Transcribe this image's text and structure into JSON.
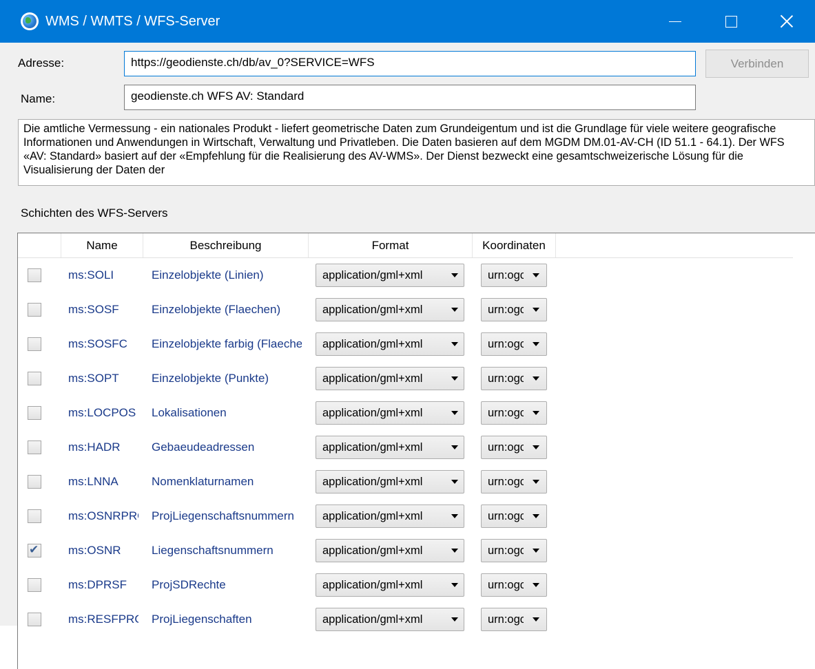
{
  "window": {
    "title": "WMS / WMTS / WFS-Server"
  },
  "form": {
    "address_label": "Adresse:",
    "address_value": "https://geodienste.ch/db/av_0?SERVICE=WFS",
    "connect_button": "Verbinden",
    "name_label": "Name:",
    "name_value": "geodienste.ch WFS AV: Standard",
    "description": "Die amtliche Vermessung - ein nationales Produkt - liefert geometrische Daten zum Grundeigentum und ist die Grundlage für viele weitere geografische Informationen und Anwendungen in Wirtschaft, Verwaltung und Privatleben. Die Daten basieren auf dem MGDM DM.01-AV-CH (ID 51.1 - 64.1). Der WFS «AV: Standard» basiert auf der «Empfehlung für die Realisierung des AV-WMS». Der Dienst bezweckt eine gesamtschweizerische Lösung für die Visualisierung der Daten der"
  },
  "layers": {
    "section_label": "Schichten des WFS-Servers",
    "columns": {
      "name": "Name",
      "description": "Beschreibung",
      "format": "Format",
      "coordinates": "Koordinaten"
    },
    "rows": [
      {
        "checked": false,
        "name": "ms:SOLI",
        "description": "Einzelobjekte (Linien)",
        "format": "application/gml+xml",
        "coords": "urn:ogc"
      },
      {
        "checked": false,
        "name": "ms:SOSF",
        "description": "Einzelobjekte (Flaechen)",
        "format": "application/gml+xml",
        "coords": "urn:ogc"
      },
      {
        "checked": false,
        "name": "ms:SOSFC",
        "description": "Einzelobjekte farbig (Flaechen)",
        "format": "application/gml+xml",
        "coords": "urn:ogc"
      },
      {
        "checked": false,
        "name": "ms:SOPT",
        "description": "Einzelobjekte (Punkte)",
        "format": "application/gml+xml",
        "coords": "urn:ogc"
      },
      {
        "checked": false,
        "name": "ms:LOCPOS",
        "description": "Lokalisationen",
        "format": "application/gml+xml",
        "coords": "urn:ogc"
      },
      {
        "checked": false,
        "name": "ms:HADR",
        "description": "Gebaeudeadressen",
        "format": "application/gml+xml",
        "coords": "urn:ogc"
      },
      {
        "checked": false,
        "name": "ms:LNNA",
        "description": "Nomenklaturnamen",
        "format": "application/gml+xml",
        "coords": "urn:ogc"
      },
      {
        "checked": false,
        "name": "ms:OSNRPROJ",
        "description": "ProjLiegenschaftsnummern",
        "format": "application/gml+xml",
        "coords": "urn:ogc"
      },
      {
        "checked": true,
        "name": "ms:OSNR",
        "description": "Liegenschaftsnummern",
        "format": "application/gml+xml",
        "coords": "urn:ogc"
      },
      {
        "checked": false,
        "name": "ms:DPRSF",
        "description": "ProjSDRechte",
        "format": "application/gml+xml",
        "coords": "urn:ogc"
      },
      {
        "checked": false,
        "name": "ms:RESFPROJ",
        "description": "ProjLiegenschaften",
        "format": "application/gml+xml",
        "coords": "urn:ogc"
      }
    ]
  },
  "colors": {
    "titlebar": "#0078d7",
    "link_text": "#1a3a8a",
    "check": "#3b5f93"
  }
}
